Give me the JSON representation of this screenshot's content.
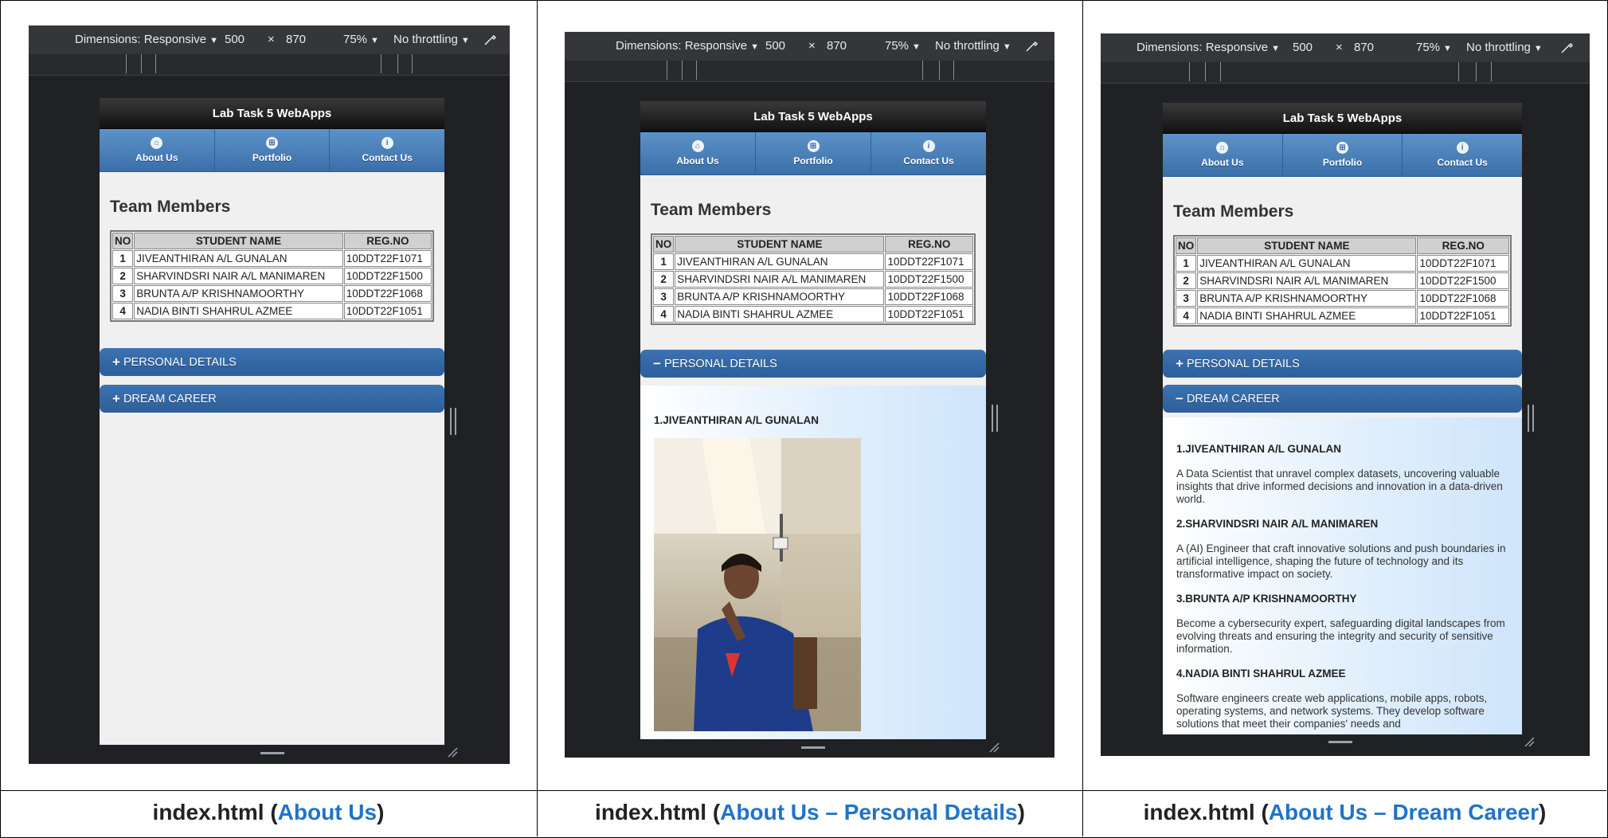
{
  "devtools": {
    "dimensions_label": "Dimensions: Responsive",
    "width": "500",
    "times": "×",
    "height": "870",
    "zoom": "75%",
    "throttling": "No throttling"
  },
  "app": {
    "header_title": "Lab Task 5 WebApps",
    "nav": [
      {
        "label": "About Us",
        "icon": "home-icon"
      },
      {
        "label": "Portfolio",
        "icon": "grid-icon"
      },
      {
        "label": "Contact Us",
        "icon": "info-icon"
      }
    ],
    "team_title": "Team Members",
    "table": {
      "headers": [
        "NO",
        "STUDENT NAME",
        "REG.NO"
      ],
      "rows": [
        {
          "no": "1",
          "name": "JIVEANTHIRAN A/L GUNALAN",
          "reg": "10DDT22F1071"
        },
        {
          "no": "2",
          "name": "SHARVINDSRI NAIR A/L MANIMAREN",
          "reg": "10DDT22F1500"
        },
        {
          "no": "3",
          "name": "BRUNTA A/P KRISHNAMOORTHY",
          "reg": "10DDT22F1068"
        },
        {
          "no": "4",
          "name": "NADIA BINTI SHAHRUL AZMEE",
          "reg": "10DDT22F1051"
        }
      ]
    },
    "personal_details": "PERSONAL DETAILS",
    "dream_career": "DREAM CAREER",
    "plus": "+",
    "minus": "−",
    "personal_heading": "1.JIVEANTHIRAN A/L GUNALAN",
    "career_items": [
      {
        "name": "1.JIVEANTHIRAN A/L GUNALAN",
        "text": "A Data Scientist that unravel complex datasets, uncovering valuable insights that drive informed decisions and innovation in a data-driven world."
      },
      {
        "name": "2.SHARVINDSRI NAIR A/L MANIMAREN",
        "text": "A (AI) Engineer that craft innovative solutions and push boundaries in artificial intelligence, shaping the future of technology and its transformative impact on society."
      },
      {
        "name": "3.BRUNTA A/P KRISHNAMOORTHY",
        "text": "Become a cybersecurity expert, safeguarding digital landscapes from evolving threats and ensuring the integrity and security of sensitive information."
      },
      {
        "name": "4.NADIA BINTI SHAHRUL AZMEE",
        "text": "Software engineers create web applications, mobile apps, robots, operating systems, and network systems. They develop software solutions that meet their companies' needs and"
      }
    ]
  },
  "captions": [
    {
      "prefix": "index.html (",
      "link": "About Us",
      "suffix": ")"
    },
    {
      "prefix": "index.html (",
      "link": "About Us – Personal Details",
      "suffix": ")"
    },
    {
      "prefix": "index.html (",
      "link": "About Us – Dream Career",
      "suffix": ")"
    }
  ]
}
